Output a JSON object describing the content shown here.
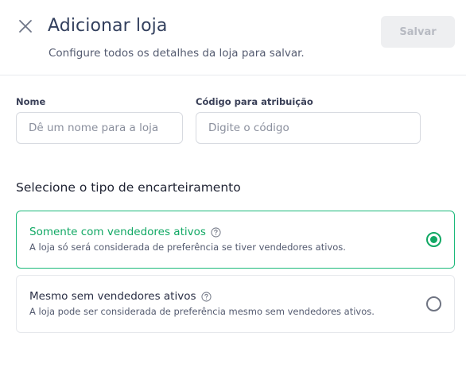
{
  "header": {
    "title": "Adicionar loja",
    "subtitle": "Configure todos os detalhes da loja para salvar.",
    "save_label": "Salvar",
    "close_icon": "close-icon"
  },
  "form": {
    "name": {
      "label": "Nome",
      "placeholder": "Dê um nome para a loja",
      "value": ""
    },
    "code": {
      "label": "Código para atribuição",
      "placeholder": "Digite o código",
      "value": ""
    }
  },
  "allocation": {
    "title": "Selecione o tipo de encarteiramento",
    "options": [
      {
        "title": "Somente com vendedores ativos",
        "description": "A loja só será considerada de preferência se tiver vendedores ativos.",
        "selected": true,
        "help_icon": "help-circle-icon"
      },
      {
        "title": "Mesmo sem vendedores ativos",
        "description": "A loja pode ser considerada de preferência mesmo sem vendedores ativos.",
        "selected": false,
        "help_icon": "help-circle-icon"
      }
    ]
  },
  "colors": {
    "accent": "#11a864",
    "title": "#33405e",
    "save_disabled_bg": "#eeeff1",
    "save_disabled_text": "#b7bac2"
  }
}
